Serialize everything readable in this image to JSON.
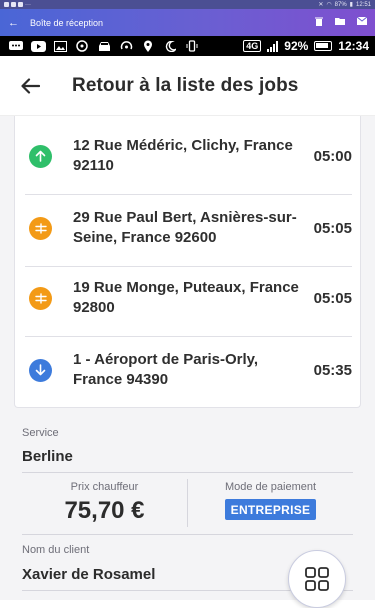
{
  "outer_status": {
    "battery": "87%",
    "time": "12:51"
  },
  "titlebar": {
    "title": "Boîte de réception"
  },
  "phone_status": {
    "network": "4G",
    "battery": "92%",
    "time": "12:34"
  },
  "appbar": {
    "title": "Retour à la liste des jobs"
  },
  "stops": [
    {
      "address": "12 Rue Médéric, Clichy, France 92110",
      "time": "05:00",
      "icon": "arrow-up-icon",
      "color": "#2fbf6a"
    },
    {
      "address": "29 Rue Paul Bert, Asnières-sur-Seine, France 92600",
      "time": "05:05",
      "icon": "waypoint-icon",
      "color": "#f39a16"
    },
    {
      "address": "19 Rue Monge, Puteaux, France 92800",
      "time": "05:05",
      "icon": "waypoint-icon",
      "color": "#f39a16"
    },
    {
      "address": "1 - Aéroport de Paris-Orly, France 94390",
      "time": "05:35",
      "icon": "arrow-down-icon",
      "color": "#3d7bdc"
    }
  ],
  "service": {
    "label": "Service",
    "value": "Berline"
  },
  "price": {
    "label": "Prix chauffeur",
    "value": "75,70 €"
  },
  "payment": {
    "label": "Mode de paiement",
    "value": "ENTREPRISE",
    "color": "#3d7bdc"
  },
  "client": {
    "label": "Nom du client",
    "value": "Xavier de Rosamel"
  },
  "fab": {
    "icon": "grid-icon"
  }
}
